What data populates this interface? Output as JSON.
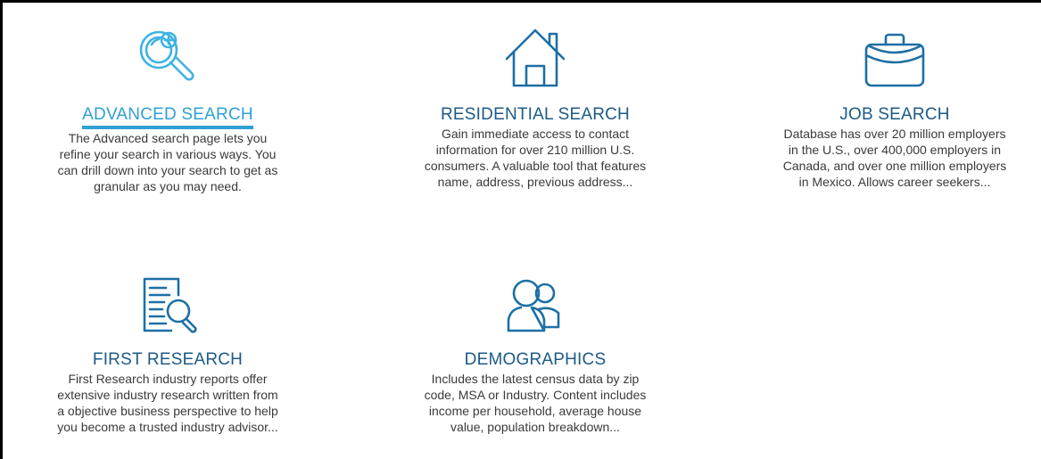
{
  "cards": [
    {
      "title": "ADVANCED SEARCH",
      "lines": [
        "The Advanced search page lets you",
        "refine your search in various ways. You",
        "can drill down into your search to get as",
        "granular as you may need."
      ],
      "icon": "magnifier-icon",
      "active": true
    },
    {
      "title": "RESIDENTIAL SEARCH",
      "lines": [
        "Gain immediate access to contact",
        "information for over 210 million U.S.",
        "consumers. A valuable tool that features",
        "name, address, previous address..."
      ],
      "icon": "house-icon",
      "active": false
    },
    {
      "title": "JOB SEARCH",
      "lines": [
        "Database has over 20 million employers",
        "in the U.S., over 400,000 employers in",
        "Canada, and over one million employers",
        "in Mexico. Allows career seekers..."
      ],
      "icon": "briefcase-icon",
      "active": false
    },
    {
      "title": "FIRST RESEARCH",
      "lines": [
        "First Research industry reports offer",
        "extensive industry research written from",
        "a objective business perspective to help",
        "you become a trusted industry advisor..."
      ],
      "icon": "document-search-icon",
      "active": false
    },
    {
      "title": "DEMOGRAPHICS",
      "lines": [
        "Includes the latest census data by zip",
        "code, MSA or Industry. Content includes",
        "income per household, average house",
        "value, population breakdown..."
      ],
      "icon": "people-icon",
      "active": false
    }
  ],
  "colors": {
    "title": "#1d5a86",
    "active_title": "#2fa0d4",
    "icon_blue": "#1d6fa5",
    "icon_light": "#3eb3e0",
    "text": "#3a3a3a"
  }
}
